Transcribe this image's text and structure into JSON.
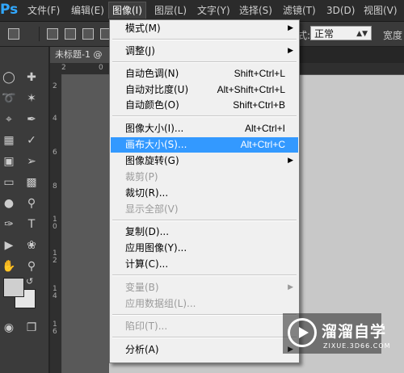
{
  "app": {
    "logo": "Ps"
  },
  "menubar": {
    "items": [
      {
        "label": "文件(F)"
      },
      {
        "label": "编辑(E)"
      },
      {
        "label": "图像(I)"
      },
      {
        "label": "图层(L)"
      },
      {
        "label": "文字(Y)"
      },
      {
        "label": "选择(S)"
      },
      {
        "label": "滤镜(T)"
      },
      {
        "label": "3D(D)"
      },
      {
        "label": "视图(V)"
      }
    ]
  },
  "options": {
    "mode_label": "式:",
    "mode_value": "正常",
    "width_label": "宽度"
  },
  "document": {
    "tab_title": "未标题-1 @"
  },
  "rulers": {
    "top": [
      "2",
      "0"
    ],
    "left": [
      "2",
      "4",
      "6",
      "8",
      "1\n0",
      "1\n2",
      "1\n4",
      "1\n6"
    ]
  },
  "image_menu": {
    "items": [
      {
        "label": "模式(M)",
        "shortcut": "",
        "submenu": true,
        "disabled": false
      },
      {
        "label": "调整(J)",
        "shortcut": "",
        "submenu": true,
        "disabled": false
      },
      {
        "label": "自动色调(N)",
        "shortcut": "Shift+Ctrl+L",
        "submenu": false,
        "disabled": false
      },
      {
        "label": "自动对比度(U)",
        "shortcut": "Alt+Shift+Ctrl+L",
        "submenu": false,
        "disabled": false
      },
      {
        "label": "自动颜色(O)",
        "shortcut": "Shift+Ctrl+B",
        "submenu": false,
        "disabled": false
      },
      {
        "label": "图像大小(I)...",
        "shortcut": "Alt+Ctrl+I",
        "submenu": false,
        "disabled": false
      },
      {
        "label": "画布大小(S)...",
        "shortcut": "Alt+Ctrl+C",
        "submenu": false,
        "disabled": false,
        "highlighted": true
      },
      {
        "label": "图像旋转(G)",
        "shortcut": "",
        "submenu": true,
        "disabled": false
      },
      {
        "label": "裁剪(P)",
        "shortcut": "",
        "submenu": false,
        "disabled": true
      },
      {
        "label": "裁切(R)...",
        "shortcut": "",
        "submenu": false,
        "disabled": false
      },
      {
        "label": "显示全部(V)",
        "shortcut": "",
        "submenu": false,
        "disabled": true
      },
      {
        "label": "复制(D)...",
        "shortcut": "",
        "submenu": false,
        "disabled": false
      },
      {
        "label": "应用图像(Y)...",
        "shortcut": "",
        "submenu": false,
        "disabled": false
      },
      {
        "label": "计算(C)...",
        "shortcut": "",
        "submenu": false,
        "disabled": false
      },
      {
        "label": "变量(B)",
        "shortcut": "",
        "submenu": true,
        "disabled": true
      },
      {
        "label": "应用数据组(L)...",
        "shortcut": "",
        "submenu": false,
        "disabled": true
      },
      {
        "label": "陷印(T)...",
        "shortcut": "",
        "submenu": false,
        "disabled": true
      },
      {
        "label": "分析(A)",
        "shortcut": "",
        "submenu": true,
        "disabled": false
      }
    ]
  },
  "watermark": {
    "title": "溜溜自学",
    "url": "ZIXUE.3D66.COM"
  },
  "colors": {
    "highlight": "#3399ff",
    "menu_bg": "#f0f0f0",
    "ps_blue": "#31a8ff"
  }
}
